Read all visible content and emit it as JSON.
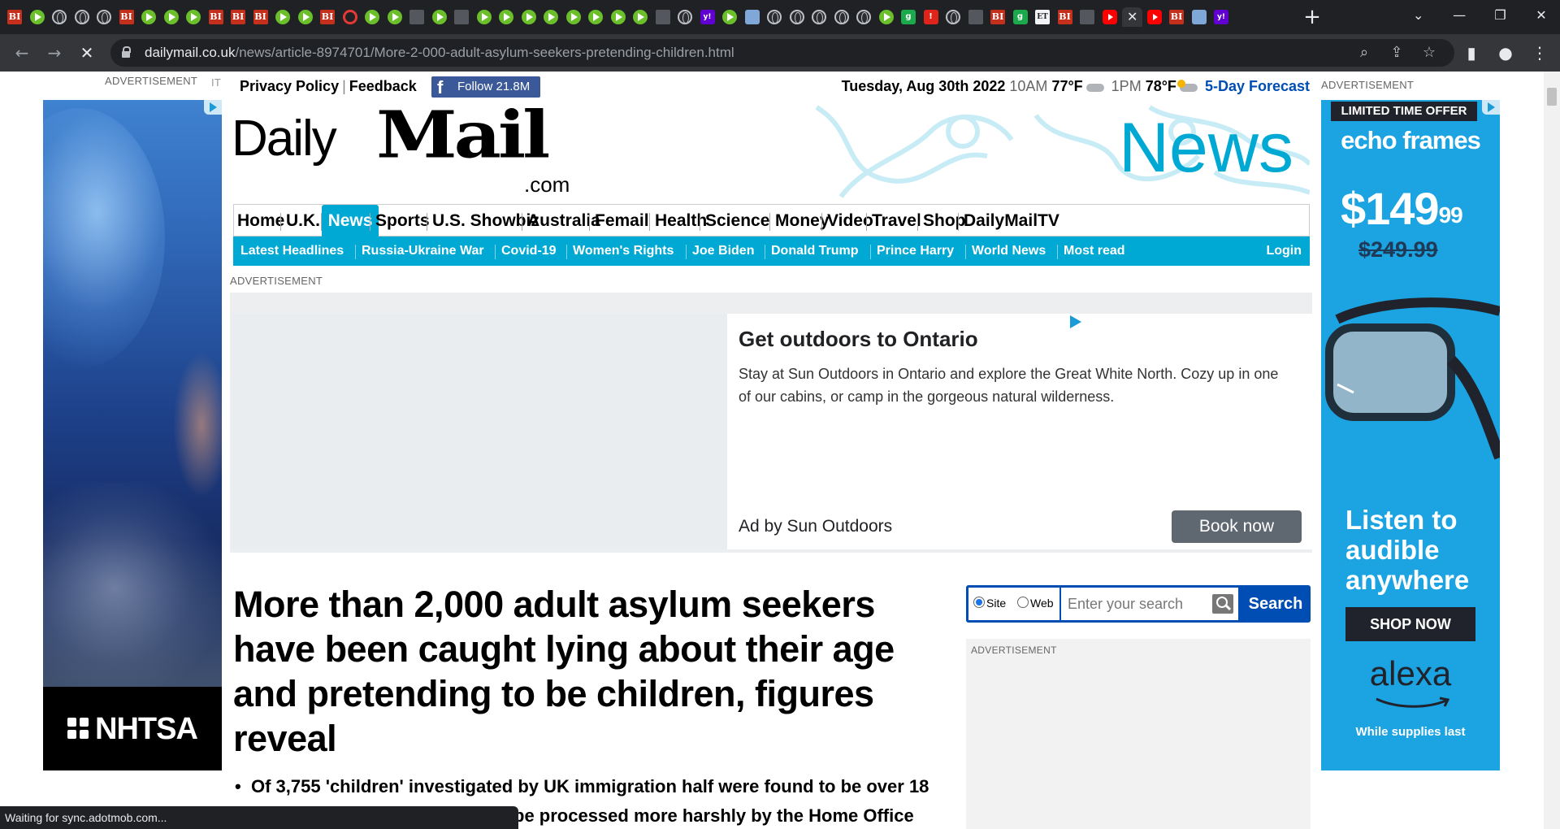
{
  "browser": {
    "tab_icons": [
      "bi",
      "play",
      "globe",
      "globe",
      "globe",
      "bi",
      "play",
      "play",
      "play",
      "bi",
      "bi",
      "bi",
      "play",
      "play",
      "bi",
      "c",
      "play",
      "play",
      "sq",
      "play",
      "sq",
      "play",
      "play",
      "play",
      "play",
      "play",
      "play",
      "play",
      "play",
      "sq",
      "globe",
      "yh",
      "play",
      "tw",
      "globe",
      "globe",
      "globe",
      "globe",
      "globe",
      "play",
      "grn",
      "red",
      "globe",
      "sq",
      "bi",
      "grn",
      "et",
      "bi",
      "sq",
      "yt",
      "yt",
      "bi",
      "tw",
      "yh"
    ],
    "active_tab_close": "✕",
    "new_tab": "+",
    "url_host": "dailymail.co.uk",
    "url_path": "/news/article-8974701/More-2-000-adult-asylum-seekers-pretending-children.html",
    "status_text": "Waiting for sync.adotmob.com..."
  },
  "page": {
    "ad_label": "ADVERTISEMENT",
    "left_ad_label_cut": "IT",
    "top_links": [
      "Privacy Policy",
      "Feedback"
    ],
    "facebook_follow": "Follow 21.8M",
    "date": {
      "day": "Tuesday, Aug 30th 2022",
      "time1": "10AM",
      "temp1": "77°F",
      "time2": "1PM",
      "temp2": "78°F",
      "forecast": "5-Day Forecast"
    },
    "logo": {
      "daily": "Daily",
      "mail": "Mail",
      "com": ".com"
    },
    "channel": "News",
    "nav": [
      "Home",
      "U.K.",
      "News",
      "Sports",
      "U.S. Showbiz",
      "Australia",
      "Femail",
      "Health",
      "Science",
      "Money",
      "Video",
      "Travel",
      "Shop",
      "DailyMailTV"
    ],
    "nav_active": "News",
    "subnav": [
      "Latest Headlines",
      "Russia-Ukraine War",
      "Covid-19",
      "Women's Rights",
      "Joe Biden",
      "Donald Trump",
      "Prince Harry",
      "World News",
      "Most read"
    ],
    "login": "Login",
    "main_ad": {
      "title": "Get outdoors to Ontario",
      "description": "Stay at Sun Outdoors in Ontario and explore the Great White North. Cozy up in one of our cabins, or camp in the gorgeous natural wilderness.",
      "by": "Ad by Sun Outdoors",
      "button": "Book now"
    },
    "headline": "More than 2,000 adult asylum seekers have been caught lying about their age and pretending to be children, figures reveal",
    "bullets": [
      "Of 3,755 'children' investigated by UK immigration half were found to be over 18",
      "be processed more harshly by the Home Office"
    ],
    "search": {
      "site_label": "Site",
      "web_label": "Web",
      "placeholder": "Enter your search",
      "button": "Search"
    },
    "left_ad": {
      "brand": "NHTSA"
    },
    "right_ad": {
      "banner": "LIMITED TIME OFFER",
      "brand": "echo frames",
      "price": "$149",
      "price_cents": "99",
      "old_price": "$249.99",
      "tagline": "Listen to audible anywhere",
      "shop": "SHOP NOW",
      "alexa": "alexa",
      "supplies": "While supplies last"
    },
    "colors": {
      "accent": "#00a9d3",
      "search_blue": "#004db3",
      "facebook": "#3b5998"
    }
  }
}
